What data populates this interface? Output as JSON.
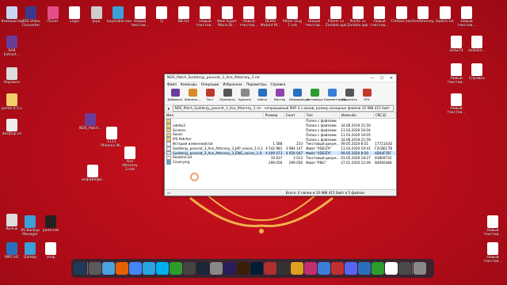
{
  "desktop": {
    "icons_left_col": [
      {
        "label": "Компьютер",
        "icon": "computer-icon",
        "color": "#c8d8f0"
      },
      {
        "label": "RAR Extract...",
        "icon": "rar-icon",
        "color": "#6a3d9a"
      },
      {
        "label": "Корзина",
        "icon": "recycle-bin-icon",
        "color": "#dddddd"
      },
      {
        "label": "portal 0.5.x",
        "icon": "folder-icon",
        "color": "#f1d06b"
      },
      {
        "label": "desktop.ini",
        "icon": "settings-file-icon",
        "color": "#eeeeee"
      },
      {
        "label": "Ярлык",
        "icon": "shortcut-icon",
        "color": "#dddddd"
      },
      {
        "label": "MPC-HC",
        "icon": "mpc-icon",
        "color": "#2a6fbb"
      }
    ],
    "icons_top_row": [
      {
        "label": "3DS Video Converter",
        "icon": "app-icon",
        "color": "#3a3a8a"
      },
      {
        "label": "iTunes",
        "icon": "itunes-icon",
        "color": "#e44d8a"
      },
      {
        "label": "Legoi",
        "icon": "document-icon",
        "color": "#ffffff"
      },
      {
        "label": "Jaya",
        "icon": "app-icon",
        "color": "#cccccc"
      },
      {
        "label": "keymaker.exe",
        "icon": "exe-icon",
        "color": "#3b9fd8"
      },
      {
        "label": "Новый текстов...",
        "icon": "text-file-icon",
        "color": "#ffffff"
      },
      {
        "label": "Q",
        "icon": "app-icon",
        "color": "#ffffff"
      },
      {
        "label": "BB.txt",
        "icon": "text-file-icon",
        "color": "#ffffff"
      },
      {
        "label": "Новый текстов...",
        "icon": "text-file-icon",
        "color": "#ffffff"
      },
      {
        "label": "New Super Mario Br...",
        "icon": "game-icon",
        "color": "#ffffff"
      },
      {
        "label": "Новый текстов...",
        "icon": "text-file-icon",
        "color": "#ffffff"
      },
      {
        "label": "DEMO Mutant M...",
        "icon": "game-icon",
        "color": "#ffffff"
      },
      {
        "label": "Metal Slug 7.nds",
        "icon": "rom-icon",
        "color": "#ffffff"
      },
      {
        "label": "Новый текстов...",
        "icon": "text-file-icon",
        "color": "#ffffff"
      },
      {
        "label": "Plants vs Zombie.apk",
        "icon": "apk-icon",
        "color": "#ffffff"
      },
      {
        "label": "Plants vs Zombie.apk",
        "icon": "apk-icon",
        "color": "#ffffff"
      },
      {
        "label": "Новый текстов...",
        "icon": "text-file-icon",
        "color": "#ffffff"
      },
      {
        "label": "Climber.nes",
        "icon": "rom-icon",
        "color": "#ffffff"
      },
      {
        "label": "AceAttorney...",
        "icon": "rom-icon",
        "color": "#ffffff"
      },
      {
        "label": "Switch.txt",
        "icon": "text-file-icon",
        "color": "#ffffff"
      },
      {
        "label": "Новый текстов...",
        "icon": "text-file-icon",
        "color": "#ffffff"
      }
    ],
    "icons_right_col": [
      {
        "label": "dsdw74",
        "icon": "text-file-icon",
        "color": "#ffffff"
      },
      {
        "label": "dsdsdm...",
        "icon": "text-file-icon",
        "color": "#ffffff"
      },
      {
        "label": "Новый текстов...",
        "icon": "text-file-icon",
        "color": "#ffffff"
      },
      {
        "label": "Новый текстов...",
        "icon": "text-file-icon",
        "color": "#ffffff"
      },
      {
        "label": "Справка",
        "icon": "help-icon",
        "color": "#ffffff"
      }
    ],
    "icons_middle": [
      {
        "label": "NDS_Patch...",
        "icon": "rar-icon",
        "color": "#6a3d9a"
      },
      {
        "label": "1111 Phoenix W...",
        "icon": "text-file-icon",
        "color": "#ffffff"
      },
      {
        "label": "Ace Attorney 3.nds",
        "icon": "rom-icon",
        "color": "#ffffff"
      },
      {
        "label": "инфайлфм...",
        "icon": "text-file-icon",
        "color": "#ffffff"
      }
    ],
    "icons_bottom_left": [
      {
        "label": "AS Backup Manager",
        "icon": "backup-icon",
        "color": "#3b9fd8"
      },
      {
        "label": "paint.net",
        "icon": "paint-icon",
        "color": "#222222"
      },
      {
        "label": "Gamep",
        "icon": "game-icon",
        "color": "#3b9fd8"
      },
      {
        "label": "vmaj",
        "icon": "document-icon",
        "color": "#ffffff"
      }
    ],
    "icons_bottom_right": [
      {
        "label": "Новый текстов...",
        "icon": "text-file-icon",
        "color": "#ffffff"
      },
      {
        "label": "Новый текстов...",
        "icon": "text-file-icon",
        "color": "#ffffff"
      }
    ]
  },
  "window": {
    "title": "NDS_Patch_Suddenjy_povorot_3_Ace_Attorney_3.rar",
    "controls": [
      "—",
      "☐",
      "✕"
    ],
    "menu": [
      "Файл",
      "Команды",
      "Операции",
      "Избранное",
      "Параметры",
      "Справка"
    ],
    "toolbar": [
      {
        "label": "Добавить",
        "icon": "add-icon",
        "color": "#6a3d9a"
      },
      {
        "label": "Извлечь...",
        "icon": "extract-icon",
        "color": "#d88a2a"
      },
      {
        "label": "Тест",
        "icon": "test-icon",
        "color": "#c0392b"
      },
      {
        "label": "Просмотр",
        "icon": "view-icon",
        "color": "#555555"
      },
      {
        "label": "Удалить",
        "icon": "delete-icon",
        "color": "#888888"
      },
      {
        "label": "Найти",
        "icon": "find-icon",
        "color": "#2a6fbb"
      },
      {
        "label": "Мастер",
        "icon": "wizard-icon",
        "color": "#8e44ad"
      },
      {
        "label": "Информация",
        "icon": "info-icon",
        "color": "#2a6fbb"
      },
      {
        "label": "Антивирус",
        "icon": "antivirus-icon",
        "color": "#2e9b2e"
      },
      {
        "label": "Комментарий",
        "icon": "comment-icon",
        "color": "#3b7dd8"
      },
      {
        "label": "Защитить",
        "icon": "protect-icon",
        "color": "#555555"
      },
      {
        "label": "SFX",
        "icon": "sfx-icon",
        "color": "#c0392b"
      }
    ],
    "address": "NDS_Patch_Suddenjy_povorot_3_Ace_Attorney_3.rar - непрерывный RAR 4.x архив, размер исходных файлов 10 988 415 байт",
    "columns": [
      "Имя",
      "Размер",
      "Сжат",
      "Тип",
      "Изменён",
      "CRC32"
    ],
    "rows": [
      {
        "name": "..",
        "size": "",
        "packed": "",
        "type": "Папка с файлами",
        "modified": "",
        "crc": "",
        "icon": "folder-icon"
      },
      {
        "name": "xdelta3",
        "size": "",
        "packed": "",
        "type": "Папка с файлами",
        "modified": "24.06.2019 21:59",
        "crc": "",
        "icon": "folder-icon"
      },
      {
        "name": "Screens",
        "size": "",
        "packed": "",
        "type": "Папка с файлами",
        "modified": "11.03.2020 16:04",
        "crc": "",
        "icon": "folder-icon"
      },
      {
        "name": "Saves",
        "size": "",
        "packed": "",
        "type": "Папка с файлами",
        "modified": "11.03.2020 16:05",
        "crc": "",
        "icon": "folder-icon"
      },
      {
        "name": "IPS Patcher",
        "size": "",
        "packed": "",
        "type": "Папка с файлами",
        "modified": "24.06.2019 21:59",
        "crc": "",
        "icon": "folder-icon"
      },
      {
        "name": "История изменений.txt",
        "size": "1 588",
        "packed": "233",
        "type": "Текстовый докум...",
        "modified": "09.05.2020 8:51",
        "crc": "1772143D",
        "icon": "text-file-icon"
      },
      {
        "name": "Suddenjy_povorot_3_Ace_Attorney_3_JAP_voices_1.0.2.x.delta",
        "size": "4 542 981",
        "packed": "3 984 147",
        "type": "Файл \"XDELTA\"",
        "modified": "11.03.2020 19:41",
        "crc": "F2CBEC7B",
        "icon": "generic-file-icon"
      },
      {
        "name": "Suddenjy_povorot_3_Ace_Attorney_3_ENG_voices_1.0.2.x.delta",
        "size": "4 409 473",
        "packed": "4 054 047",
        "type": "Файл \"XDELTA\"",
        "modified": "09.05.2020 8:50",
        "crc": "4B44FF6F",
        "icon": "generic-file-icon",
        "selected": true
      },
      {
        "name": "Readme.txt",
        "size": "19 637",
        "packed": "3 013",
        "type": "Текстовый докум...",
        "modified": "03.05.2020 18:27",
        "crc": "83809732",
        "icon": "text-file-icon"
      },
      {
        "name": "Cover.png",
        "size": "299 056",
        "packed": "299 056",
        "type": "Файл \"PNG\"",
        "modified": "27.01.2020 12:49",
        "crc": "B4092484",
        "icon": "image-file-icon"
      }
    ],
    "status_right": "Всего: 4 папки и 10 988 415 байт в 5 файлах"
  },
  "dock": [
    {
      "icon": "windows-icon",
      "color": "#1f3a5a"
    },
    {
      "icon": "app-icon",
      "color": "#5a5a5a"
    },
    {
      "icon": "finder-icon",
      "color": "#4aa3df"
    },
    {
      "icon": "firefox-icon",
      "color": "#e66000"
    },
    {
      "icon": "chrome-icon",
      "color": "#4285f4"
    },
    {
      "icon": "telegram-icon",
      "color": "#2aa3e0"
    },
    {
      "icon": "skype-icon",
      "color": "#00aff0"
    },
    {
      "icon": "utorrent-icon",
      "color": "#2e9b2e"
    },
    {
      "icon": "video-icon",
      "color": "#444444"
    },
    {
      "icon": "steam-icon",
      "color": "#1b2838"
    },
    {
      "icon": "settings-icon",
      "color": "#888888"
    },
    {
      "icon": "after-effects-icon",
      "color": "#2a1d5a"
    },
    {
      "icon": "illustrator-icon",
      "color": "#3a1e08"
    },
    {
      "icon": "photoshop-icon",
      "color": "#001d34"
    },
    {
      "icon": "video-editor-icon",
      "color": "#b03030"
    },
    {
      "icon": "player-icon",
      "color": "#333333"
    },
    {
      "icon": "media-icon",
      "color": "#e0a020"
    },
    {
      "icon": "music-icon",
      "color": "#c03070"
    },
    {
      "icon": "browser-icon",
      "color": "#3b7dd8"
    },
    {
      "icon": "video-icon",
      "color": "#c03030"
    },
    {
      "icon": "discord-icon",
      "color": "#5865f2"
    },
    {
      "icon": "app-icon",
      "color": "#2a6fbb"
    },
    {
      "icon": "chart-icon",
      "color": "#2e9b2e"
    },
    {
      "icon": "calendar-icon",
      "color": "#ffffff"
    },
    {
      "icon": "app-icon",
      "color": "#4a4a4a"
    },
    {
      "icon": "trash-icon",
      "color": "#888888"
    }
  ]
}
